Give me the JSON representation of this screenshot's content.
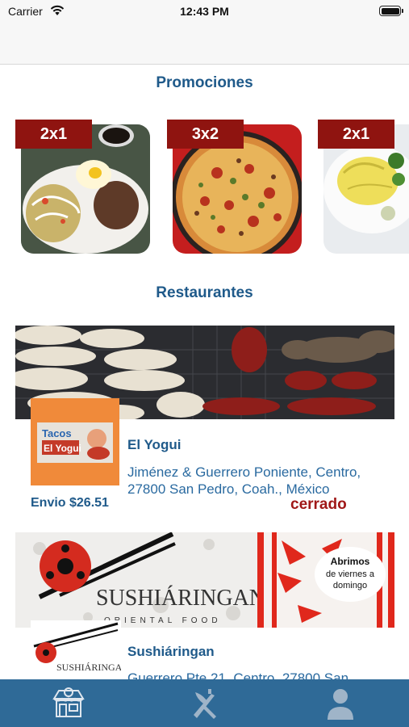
{
  "status_bar": {
    "carrier": "Carrier",
    "time": "12:43 PM"
  },
  "promotions": {
    "title": "Promociones",
    "items": [
      {
        "badge": "2x1",
        "image": "chilaquiles-plate"
      },
      {
        "badge": "3x2",
        "image": "pizza"
      },
      {
        "badge": "2x1",
        "image": "omelette"
      }
    ]
  },
  "restaurants": {
    "title": "Restaurantes",
    "items": [
      {
        "name": "El Yogui",
        "address": "Jiménez & Guerrero Poniente, Centro, 27800 San Pedro, Coah., México",
        "shipping": "Envio $26.51",
        "status": "cerrado",
        "logo_text": [
          "Tacos",
          "El Yogui"
        ]
      },
      {
        "name": "Sushiáringan",
        "address": "Guerrero Pte 21, Centro, 27800 San",
        "banner_brand": "SUSHIÁRINGAN",
        "banner_tagline": "ORIENTAL FOOD",
        "banner_note": [
          "Abrimos",
          "de viernes a",
          "domingo"
        ],
        "logo_brand": "SUSHIÁRINGAN"
      }
    ]
  },
  "tab_bar": {
    "tabs": [
      {
        "icon": "store-icon",
        "active": true
      },
      {
        "icon": "fork-knife-icon",
        "active": false
      },
      {
        "icon": "person-icon",
        "active": false
      }
    ]
  },
  "colors": {
    "accent": "#1f5a8a",
    "badge": "#8f1410",
    "tabbar": "#2f6a97",
    "closed": "#a01818"
  }
}
